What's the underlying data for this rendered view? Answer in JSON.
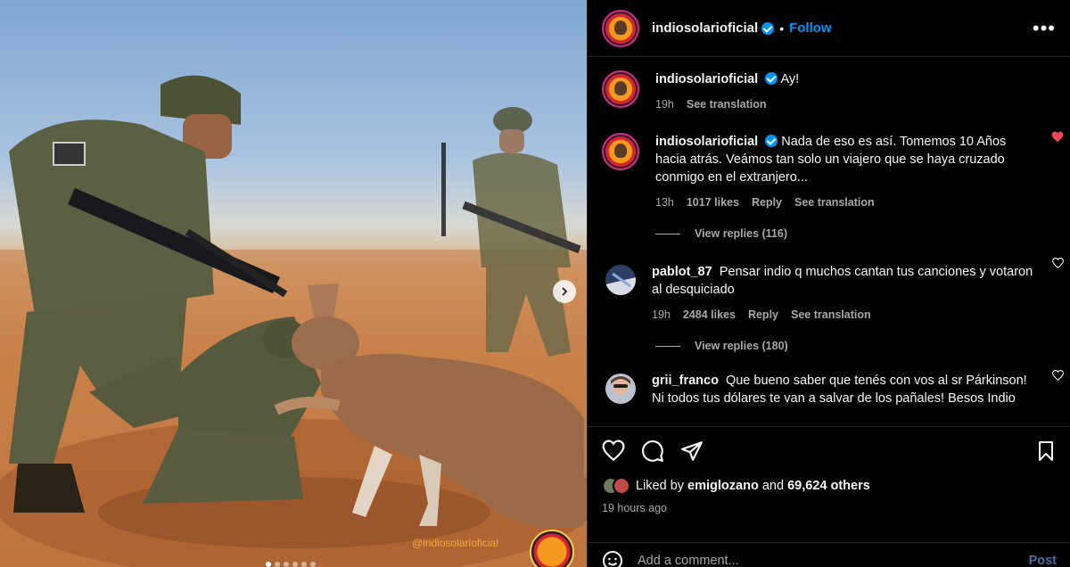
{
  "header": {
    "username": "indiosolarioficial",
    "separator": "•",
    "follow_label": "Follow",
    "more_label": "•••"
  },
  "media": {
    "watermark": "@indiosolarioficial",
    "dot_count": 6,
    "active_dot": 0
  },
  "comments": [
    {
      "user": "indiosolarioficial",
      "verified": true,
      "text": "Ay!",
      "time": "19h",
      "likes": "",
      "reply": "",
      "translate": "See translation"
    },
    {
      "user": "indiosolarioficial",
      "verified": true,
      "text": "Nada de eso es así. Tomemos 10 Años hacia atrás. Veámos tan solo un viajero que se haya cruzado conmigo en el extranjero...",
      "time": "13h",
      "likes": "1017 likes",
      "reply": "Reply",
      "translate": "See translation",
      "liked": true,
      "view_replies": "View replies (116)"
    },
    {
      "user": "pablot_87",
      "verified": false,
      "text": "Pensar indio q muchos cantan tus canciones y votaron al desquiciado",
      "time": "19h",
      "likes": "2484 likes",
      "reply": "Reply",
      "translate": "See translation",
      "view_replies": "View replies (180)"
    },
    {
      "user": "grii_franco",
      "verified": false,
      "text": "Que bueno saber que tenés con vos al sr Párkinson! Ni todos tus dólares te van a salvar de los pañales! Besos Indio"
    }
  ],
  "likes": {
    "prefix": "Liked by",
    "user": "emiglozano",
    "middle": "and",
    "count": "69,624 others"
  },
  "timestamp": "19 hours ago",
  "composer": {
    "placeholder": "Add a comment...",
    "post_label": "Post"
  },
  "colors": {
    "accent": "#0095f6",
    "heart_liked": "#ed4956",
    "muted": "#a8a8a8"
  }
}
